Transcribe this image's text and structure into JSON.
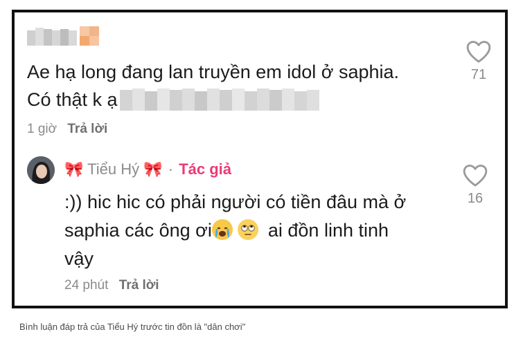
{
  "comment1": {
    "username": "",
    "text_line1": "Ae hạ long đang lan truyền em idol ở saphia.",
    "text_line2": "Có thật k ạ",
    "time": "1 giờ",
    "reply_label": "Trả lời",
    "likes": "71",
    "username_icon": "redacted-pixel-icon",
    "redacted_icon": "redacted-pixel-icon"
  },
  "comment2": {
    "author_prefix": "🎀 ",
    "author_name": "Tiểu Hý",
    "author_suffix": "🎀",
    "badge": "Tác giả",
    "text_line1": ":)) hic hic có phải người có tiền đâu mà ở",
    "text_line2_a": "saphia các ông ơi",
    "text_line2_b": "ai đồn linh tinh",
    "text_line3": "vậy",
    "emoji_1": "crying-face-icon",
    "emoji_2": "eye-roll-face-icon",
    "time": "24 phút",
    "reply_label": "Trả lời",
    "likes": "16",
    "avatar_icon": "avatar-photo-icon"
  },
  "caption": "Bình luận đáp trả của Tiểu Hý trước tin đồn là \"dân chơi\"",
  "colors": {
    "border": "#111111",
    "pink": "#ea3b74",
    "gray_text": "#8a8a8a"
  }
}
